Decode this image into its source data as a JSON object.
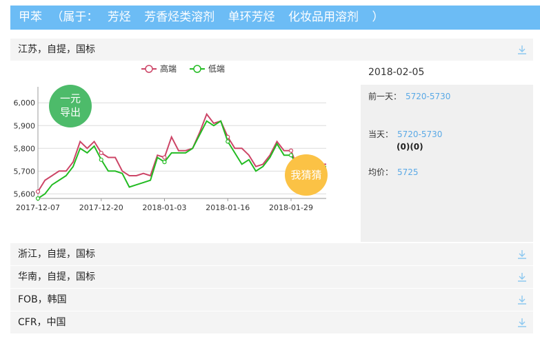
{
  "title": {
    "product": "甲苯",
    "belongs_prefix": "（属于：",
    "categories": [
      "芳烃",
      "芳香烃类溶剂",
      "单环芳烃",
      "化妆品用溶剂"
    ],
    "belongs_suffix": "）"
  },
  "regions": [
    {
      "label": "江苏，自提，国标"
    },
    {
      "label": "浙江，自提，国标"
    },
    {
      "label": "华南，自提，国标"
    },
    {
      "label": "FOB，韩国"
    },
    {
      "label": "CFR，中国"
    }
  ],
  "buttons": {
    "export": "一元\n导出",
    "export_line1": "一元",
    "export_line2": "导出",
    "guess": "我猜猜"
  },
  "panel": {
    "date": "2018-02-05",
    "prev_label": "前一天：",
    "prev_value": "5720-5730",
    "today_label": "当天：",
    "today_value": "5720-5730",
    "today_change": "(0)(0)",
    "avg_label": "均价：",
    "avg_value": "5725"
  },
  "colors": {
    "high": "#cc4466",
    "low": "#22bb22",
    "accent": "#6cbcf5"
  },
  "chart_data": {
    "type": "line",
    "title": "",
    "xlabel": "",
    "ylabel": "",
    "ylim": [
      5580,
      6040
    ],
    "yticks": [
      5600,
      5700,
      5800,
      5900,
      6000
    ],
    "ytick_labels": [
      "5,600",
      "5,700",
      "5,800",
      "5,900",
      "6,000"
    ],
    "xtick_labels": [
      "2017-12-07",
      "2017-12-20",
      "2018-01-03",
      "2018-01-16",
      "2018-01-29"
    ],
    "xtick_index": [
      0,
      9,
      18,
      27,
      36
    ],
    "legend_position": "top-center",
    "x_count": 42,
    "series": [
      {
        "name": "高端",
        "color": "#cc4466",
        "values": [
          5610,
          5660,
          5680,
          5700,
          5700,
          5740,
          5830,
          5800,
          5830,
          5780,
          5760,
          5760,
          5700,
          5680,
          5680,
          5690,
          5680,
          5770,
          5760,
          5850,
          5790,
          5790,
          5800,
          5870,
          5950,
          5910,
          5920,
          5850,
          5800,
          5800,
          5770,
          5720,
          5730,
          5770,
          5830,
          5790,
          5790,
          5710,
          5730,
          5730,
          5730,
          5730
        ],
        "markers": [
          0,
          9,
          18,
          27,
          36
        ]
      },
      {
        "name": "低端",
        "color": "#22bb22",
        "values": [
          5580,
          5600,
          5640,
          5660,
          5680,
          5720,
          5800,
          5780,
          5810,
          5750,
          5700,
          5700,
          5690,
          5630,
          5640,
          5650,
          5660,
          5760,
          5740,
          5780,
          5780,
          5780,
          5800,
          5860,
          5920,
          5900,
          5920,
          5830,
          5780,
          5730,
          5750,
          5700,
          5720,
          5760,
          5820,
          5770,
          5770,
          5720,
          5720,
          5720,
          5720,
          5720
        ],
        "markers": [
          0,
          9,
          18,
          27,
          36
        ]
      }
    ]
  }
}
